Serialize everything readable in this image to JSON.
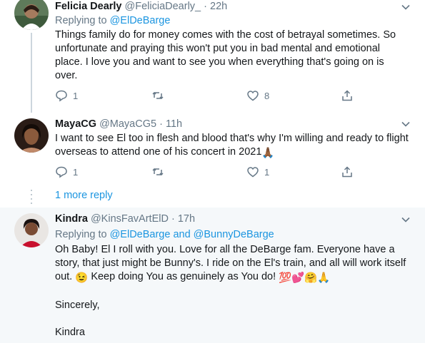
{
  "tweets": [
    {
      "name": "Felicia Dearly",
      "handle": "@FeliciaDearly_",
      "sep": "·",
      "time": "22h",
      "replying_label": "Replying to",
      "replying_to": "@ElDeBarge",
      "text": "Things family do for money comes with the cost of betrayal sometimes. So unfortunate and praying this won't put you in bad mental and emotional place. I love you and want to see you when everything that's going on is over.",
      "reply_count": "1",
      "retweet_count": "",
      "like_count": "8"
    },
    {
      "name": "MayaCG",
      "handle": "@MayaCG5",
      "sep": "·",
      "time": "11h",
      "text": "I want to see El too in flesh and blood that's why I'm willing and ready to flight overseas to attend one of his concert in 2021",
      "text_emoji": "🙏🏾",
      "reply_count": "1",
      "retweet_count": "",
      "like_count": "1"
    },
    {
      "name": "Kindra",
      "handle": "@KinsFavArtElD",
      "sep": "·",
      "time": "17h",
      "replying_label": "Replying to",
      "replying_to": "@ElDeBarge and @BunnyDeBarge",
      "text_p1_a": "Oh Baby! El I roll with you. Love for all the DeBarge fam. Everyone have a story, that just might be Bunny's. I ride on the El's train, and all will work itself out.",
      "text_p1_emoji1": "😉",
      "text_p1_b": "Keep doing You as genuinely as You do!",
      "text_p1_emoji2": "💯💕🤗🙏",
      "text_p2": "Sincerely,",
      "text_p3": "Kindra"
    }
  ],
  "more_replies": "1 more reply",
  "colors": {
    "link": "#1b95e0",
    "secondary": "#657786",
    "text": "#14171a",
    "highlight_bg": "#f5f8fa"
  },
  "icons": [
    "reply-icon",
    "retweet-icon",
    "like-icon",
    "share-icon",
    "chevron-down-icon"
  ]
}
